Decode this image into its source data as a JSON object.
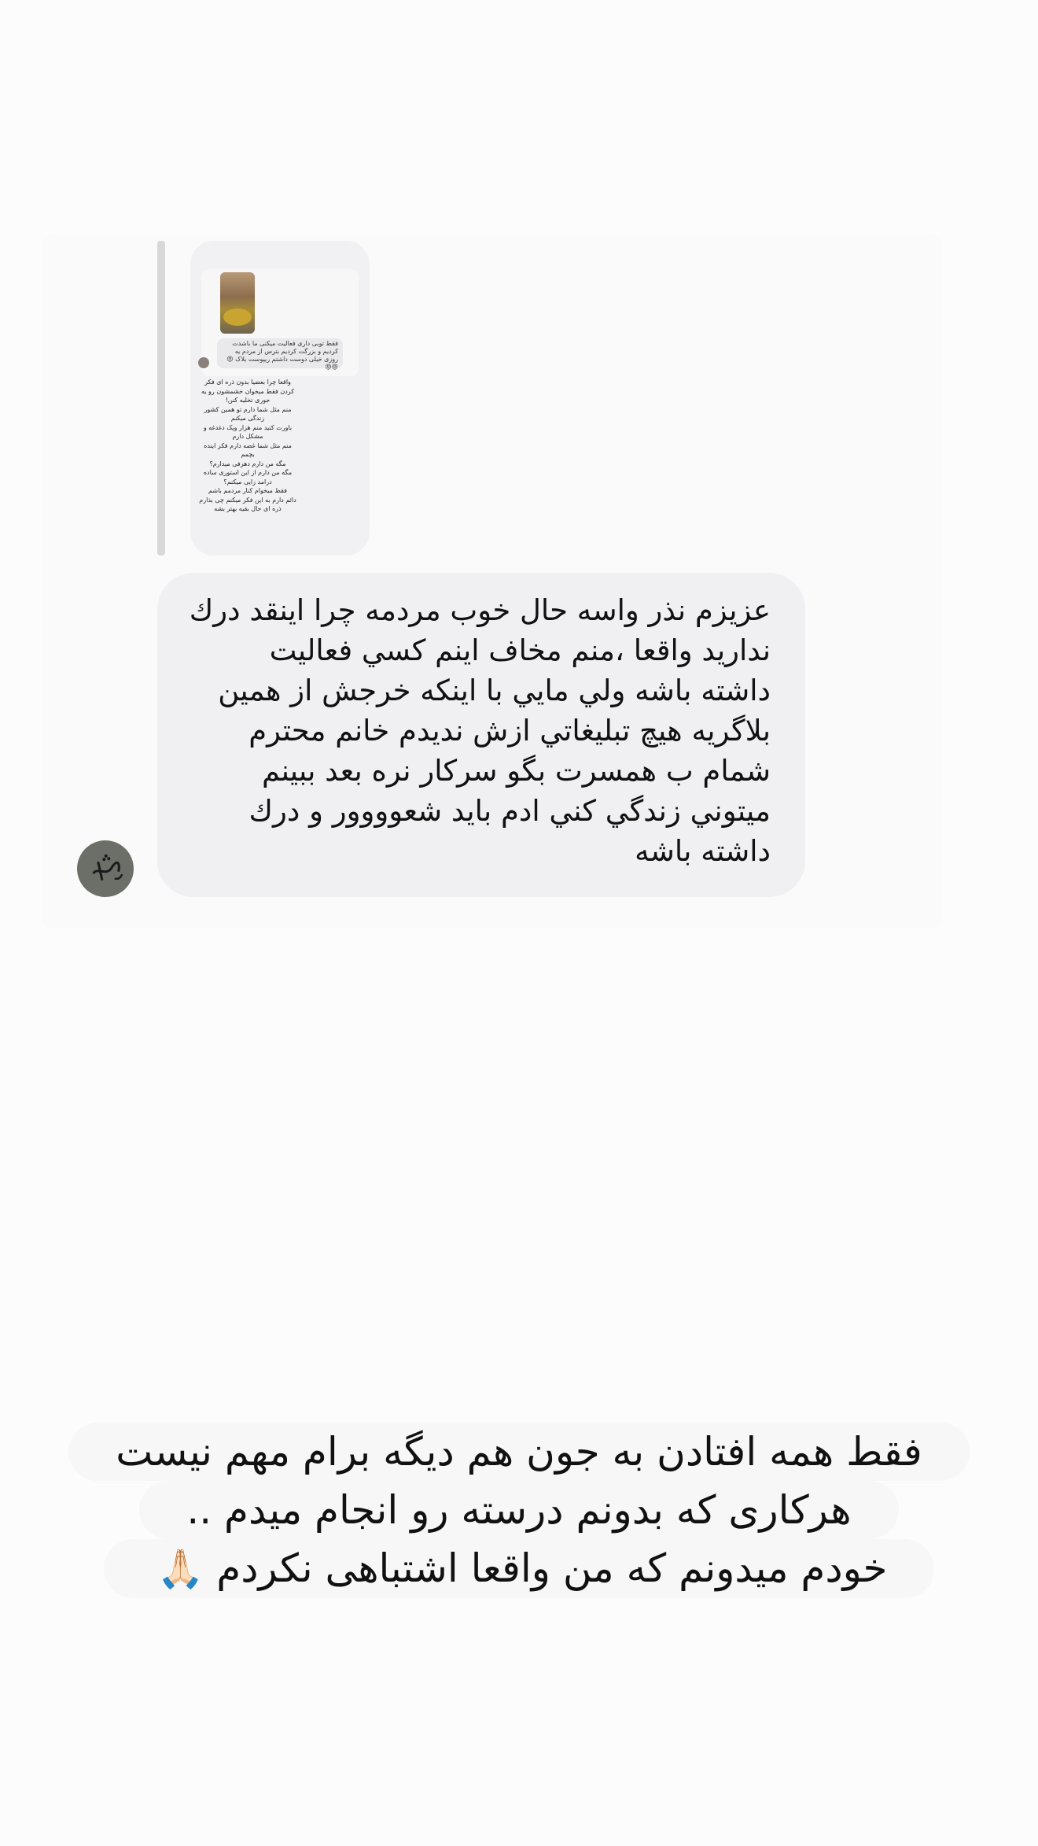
{
  "story_reply": {
    "inner_comment": "فقط توبی داری فعالیت میکنی ما باشدت کردیم و بزرگت کردیم بترس از مردم یه روزی خیلی دوست داشتم ریپوست بلاک 😡😡😡",
    "story_text": "واقعا چرا بعضیا بدون ذره ای فکر\nکردن فقط میخوان خشمشون رو یه\nجوری تخلیه کنن!\nمنم مثل شما دارم تو همین کشور\nزندگی میکنم\nباورت کنید منم هزار ویک دغدغه و\nمشکل دارم\nمنم مثل شما غصه دارم فکر اینده\nبچمم\nمگه من دارم دهرفی میدارم؟\nمگه من دارم از این استوری ساده\nدرامد زایی میکنم؟\nفقط میخوام کنار مردمم باشم\nدائم دارم به این فکر میکنم چی بذارم\nذره ای حال بقیه بهتر بشه"
  },
  "message": {
    "text": "عزیزم نذر واسه حال خوب مردمه چرا اینقد درك\nنداريد واقعا ،منم مخاف اينم كسي فعاليت\nداشته باشه ولي مايي با اينكه خرجش از همين\nبلاگريه هيچ  تبليغاتي ازش نديدم خانم محترم\nشمام ب همسرت  بگو سركار نره بعد ببينم\nميتوني زندگي كني ادم بايد شعوووور و درك\nداشته باشه"
  },
  "avatar": {
    "logo_text": "شجاع"
  },
  "caption": {
    "line1": "فقط همه افتادن به جون هم دیگه برام مهم نیست",
    "line2": "هرکاری که بدونم درسته رو انجام میدم ..",
    "line3": "خودم میدونم که من واقعا اشتباهی نکردم",
    "emoji": "🙏🏻"
  }
}
